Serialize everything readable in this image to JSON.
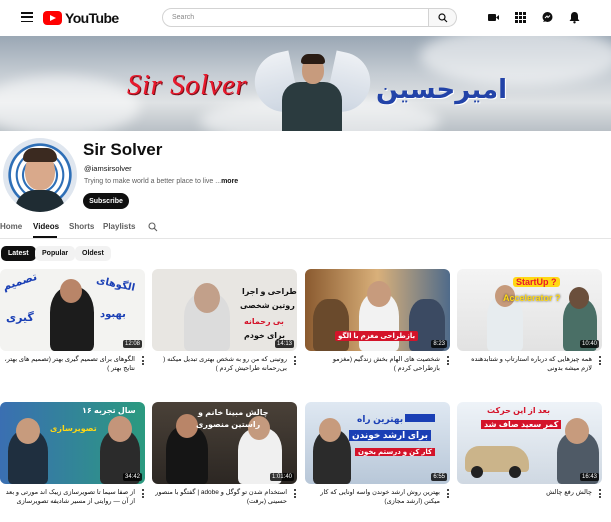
{
  "header": {
    "logo_text": "YouTube",
    "search_placeholder": "Search"
  },
  "banner": {
    "title_en": "Sir Solver",
    "title_fa": "امیرحسین"
  },
  "channel": {
    "name": "Sir Solver",
    "handle": "@iamsirsolver",
    "description": "Trying to make world a better place to live ...",
    "more_label": "more",
    "subscribe_label": "Subscribe"
  },
  "tabs": [
    {
      "label": "Home"
    },
    {
      "label": "Videos"
    },
    {
      "label": "Shorts"
    },
    {
      "label": "Playlists"
    }
  ],
  "chips": [
    {
      "label": "Latest"
    },
    {
      "label": "Popular"
    },
    {
      "label": "Oldest"
    }
  ],
  "videos": [
    {
      "duration": "12:08",
      "title": "الگوهای برای تصمیم گیری بهتر (تصمیم های بهتر، نتایج بهتر )",
      "thumb_text": [
        "تصمیم",
        "الگوهای",
        "بهبود",
        "گیری"
      ]
    },
    {
      "duration": "14:13",
      "title": "روتینی که من رو به شخص بهتری تبدیل میکنه ( بی‌رحمانه طراحیش کردم )",
      "thumb_text": [
        "طراحی و اجرا",
        "روتین شخصی",
        "بی رحمانه",
        "برای خودم"
      ]
    },
    {
      "duration": "8:23",
      "title": "شخصیت های الهام بخش زندگیم (مغزمو بازطراحی کردم )",
      "thumb_text": [
        "بازطراحی مغزم با الگو"
      ]
    },
    {
      "duration": "10:40",
      "title": "همه چیزهایی که درباره استارتاپ و شتابدهنده لازم میشه بدونی",
      "thumb_text": [
        "StartUp ?",
        "Accelerator ?"
      ]
    },
    {
      "duration": "34:42",
      "title": "از صفا سیما تا تصویرسازی زیبک اند مورتی و بعد از آن — روایتی از مسیر شادیفه تصویرسازی",
      "thumb_text": [
        "۱۶ سال تجربه",
        "تصویرسازی"
      ]
    },
    {
      "duration": "1:01:40",
      "title": "استخدام شدن تو گوگل و adobe | گفتگو با منصور حسینی (برفت)",
      "thumb_text": [
        "چالش مبینا خانم و",
        "راستین منصوری"
      ]
    },
    {
      "duration": "6:55",
      "title": "بهترین روش ارشد خوندن واسه اونایی که کار میکنن (ارشد مجازی)",
      "thumb_text": [
        "بهترین راه",
        "برای ارشد خوندن",
        "کار کن و درستم بخون"
      ]
    },
    {
      "duration": "16:43",
      "title": "چالش رفع چالش",
      "thumb_text": [
        "بعد از این حرکت",
        "کمر سعید صاف شد"
      ]
    }
  ]
}
